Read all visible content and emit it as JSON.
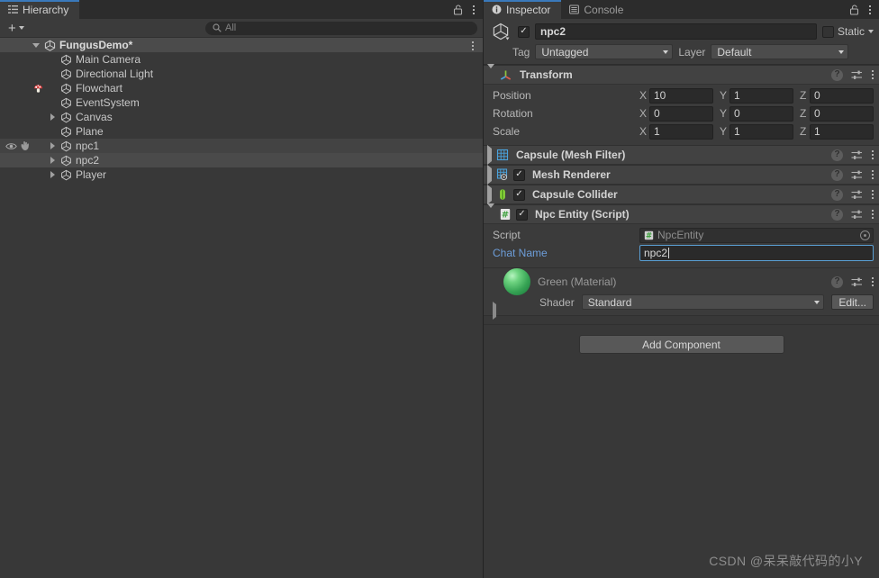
{
  "hierarchy": {
    "tab": {
      "label": "Hierarchy",
      "icon": "hierarchy-list-icon"
    },
    "lock_icon": "padlock-open-icon",
    "menu_icon": "kebab-menu-icon",
    "toolbar": {
      "add_label": "+",
      "add_icon": "plus-icon",
      "dropdown_icon": "chevron-down-icon"
    },
    "search": {
      "placeholder": "All",
      "value": "",
      "icon": "search-icon"
    },
    "scene": {
      "name": "FungusDemo*",
      "icon": "unity-scene-icon",
      "expanded": true,
      "menu_icon": "kebab-menu-icon"
    },
    "items": [
      {
        "label": "Main Camera",
        "icon": "gameobject-cube-icon",
        "expandable": false,
        "state": "normal"
      },
      {
        "label": "Directional Light",
        "icon": "gameobject-cube-icon",
        "expandable": false,
        "state": "normal"
      },
      {
        "label": "Flowchart",
        "icon": "gameobject-cube-icon",
        "expandable": false,
        "state": "normal",
        "badge": "fungus-mushroom-icon"
      },
      {
        "label": "EventSystem",
        "icon": "gameobject-cube-icon",
        "expandable": false,
        "state": "normal"
      },
      {
        "label": "Canvas",
        "icon": "gameobject-cube-icon",
        "expandable": true,
        "state": "normal"
      },
      {
        "label": "Plane",
        "icon": "gameobject-cube-icon",
        "expandable": false,
        "state": "normal"
      },
      {
        "label": "npc1",
        "icon": "gameobject-cube-icon",
        "expandable": true,
        "state": "hover",
        "visibility_icon": "eye-icon",
        "pickability_icon": "hand-icon"
      },
      {
        "label": "npc2",
        "icon": "gameobject-cube-icon",
        "expandable": true,
        "state": "selected"
      },
      {
        "label": "Player",
        "icon": "gameobject-cube-icon",
        "expandable": true,
        "state": "normal"
      }
    ]
  },
  "inspector": {
    "tabs": [
      {
        "label": "Inspector",
        "icon": "info-circle-icon",
        "active": true
      },
      {
        "label": "Console",
        "icon": "console-lines-icon",
        "active": false
      }
    ],
    "lock_icon": "padlock-open-icon",
    "menu_icon": "kebab-menu-icon",
    "gameobject": {
      "prefab_icon": "gameobject-cube-icon",
      "enabled": true,
      "enabled_mark": "✓",
      "name": "npc2",
      "static_label": "Static",
      "static_checked": false,
      "static_dropdown_icon": "chevron-down-icon",
      "tag_label": "Tag",
      "tag_value": "Untagged",
      "layer_label": "Layer",
      "layer_value": "Default"
    },
    "transform": {
      "title": "Transform",
      "icon": "transform-axis-icon",
      "expanded": true,
      "help_icon": "help-circle-icon",
      "preset_icon": "preset-sliders-icon",
      "menu_icon": "kebab-menu-icon",
      "rows": [
        {
          "label": "Position",
          "x": "10",
          "y": "1",
          "z": "0"
        },
        {
          "label": "Rotation",
          "x": "0",
          "y": "0",
          "z": "0"
        },
        {
          "label": "Scale",
          "x": "1",
          "y": "1",
          "z": "1"
        }
      ],
      "axes": [
        "X",
        "Y",
        "Z"
      ]
    },
    "components": [
      {
        "title": "Capsule (Mesh Filter)",
        "icon": "mesh-filter-icon",
        "expanded": false,
        "has_toggle": false,
        "enabled": false
      },
      {
        "title": "Mesh Renderer",
        "icon": "mesh-renderer-icon",
        "expanded": false,
        "has_toggle": true,
        "enabled": true
      },
      {
        "title": "Capsule Collider",
        "icon": "capsule-collider-icon",
        "expanded": false,
        "has_toggle": true,
        "enabled": true
      },
      {
        "title": "Npc Entity (Script)",
        "icon": "csharp-script-icon",
        "expanded": true,
        "has_toggle": true,
        "enabled": true
      }
    ],
    "script_component": {
      "script_label": "Script",
      "script_value": "NpcEntity",
      "script_icon": "csharp-script-icon",
      "picker_icon": "object-picker-icon",
      "chat_name_label": "Chat Name",
      "chat_name_value": "npc2",
      "chat_name_focused": true
    },
    "material": {
      "name": "Green (Material)",
      "preview_icon": "material-sphere-icon",
      "preview_color": "#4cb963",
      "shader_label": "Shader",
      "shader_value": "Standard",
      "edit_label": "Edit...",
      "expand_icon": "chevron-right-icon",
      "help_icon": "help-circle-icon",
      "preset_icon": "preset-sliders-icon",
      "menu_icon": "kebab-menu-icon"
    },
    "add_component_label": "Add Component",
    "common_icons": {
      "help": "help-circle-icon",
      "preset": "preset-sliders-icon",
      "menu": "kebab-menu-icon",
      "check": "✓"
    }
  },
  "watermark": "CSDN @呆呆敲代码的小Y",
  "colors": {
    "panel_bg": "#383838",
    "header_bg": "#3b3b3b",
    "component_header": "#424242",
    "tab_active": "#3b3b3b",
    "accent_blue": "#3a79bb",
    "focus_blue": "#5a9fd4",
    "link_blue": "#6d9eda",
    "material_green": "#4cb963"
  }
}
